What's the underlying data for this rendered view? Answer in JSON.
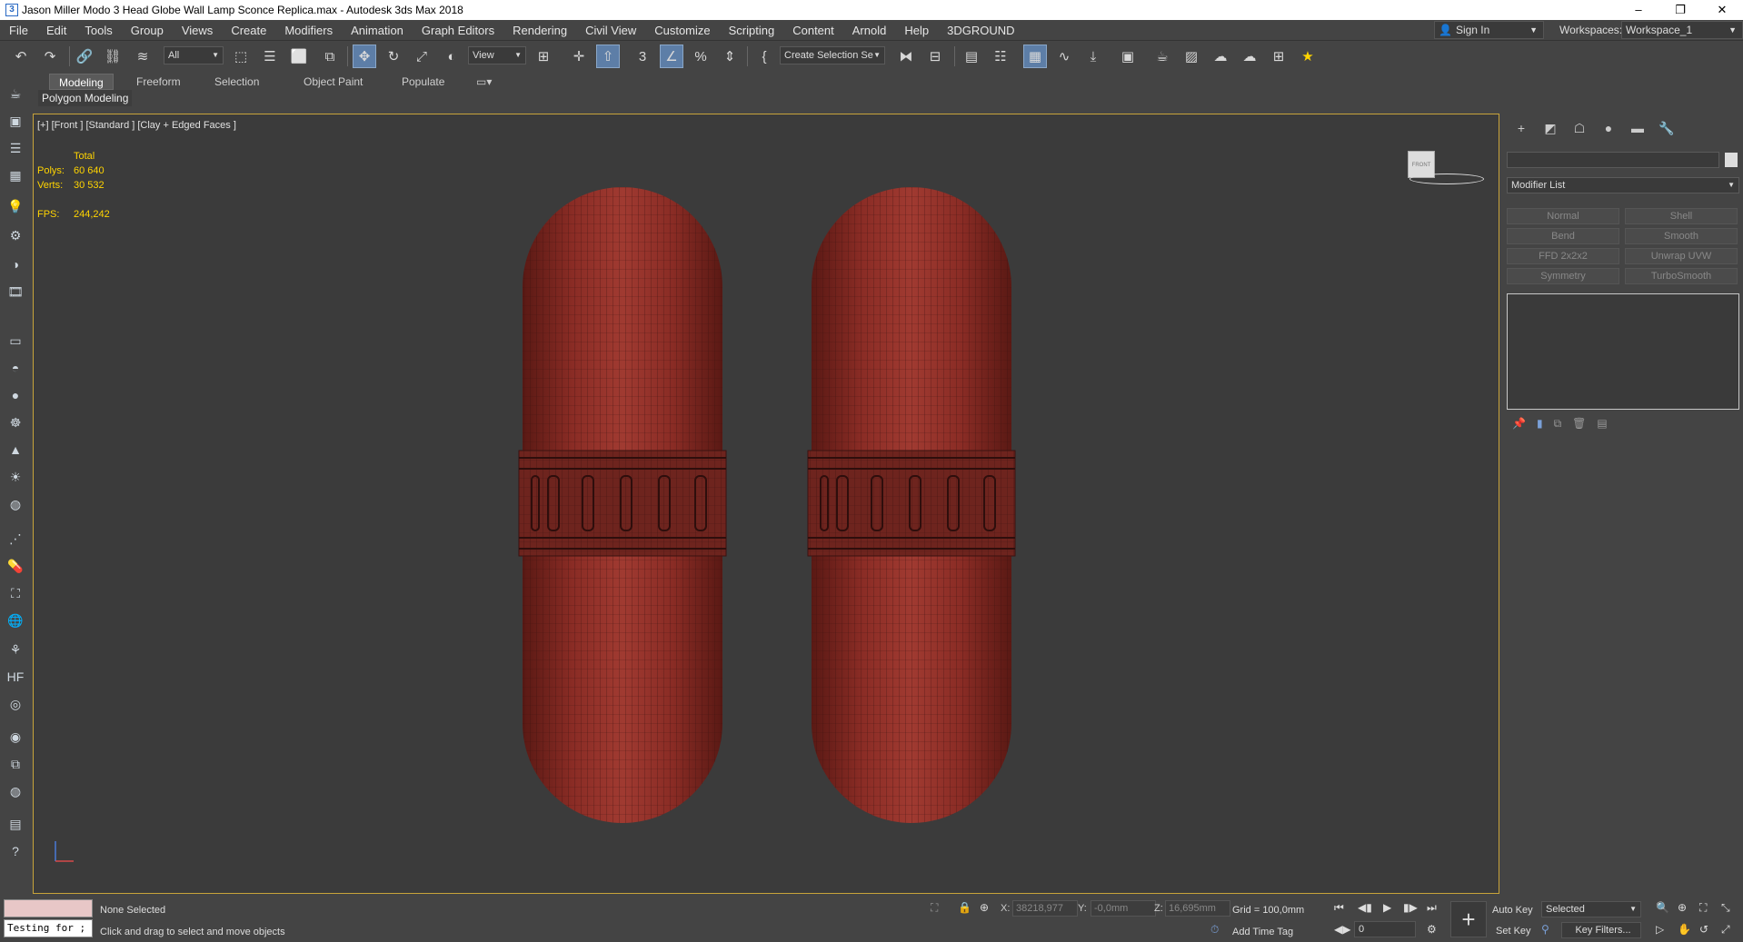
{
  "titlebar": {
    "title": "Jason Miller Modo 3 Head Globe Wall Lamp Sconce Replica.max - Autodesk 3ds Max 2018",
    "minimize": "–",
    "restore": "❐",
    "close": "✕"
  },
  "menu": {
    "items": [
      "File",
      "Edit",
      "Tools",
      "Group",
      "Views",
      "Create",
      "Modifiers",
      "Animation",
      "Graph Editors",
      "Rendering",
      "Civil View",
      "Customize",
      "Scripting",
      "Content",
      "Arnold",
      "Help",
      "3DGROUND"
    ],
    "sign_in": "Sign In",
    "workspaces_label": "Workspaces:",
    "workspace_value": "Workspace_1"
  },
  "toolbar": {
    "selection_filter": "All",
    "ref_coord": "View",
    "named_selection": "Create Selection Se"
  },
  "ribbon": {
    "tabs": [
      "Modeling",
      "Freeform",
      "Selection",
      "Object Paint",
      "Populate"
    ],
    "active_tab": "Modeling",
    "sub_label": "Polygon Modeling"
  },
  "viewport": {
    "label": "[+] [Front ] [Standard ] [Clay + Edged Faces ]",
    "stats": {
      "total_label": "Total",
      "polys_label": "Polys:",
      "polys_value": "60 640",
      "verts_label": "Verts:",
      "verts_value": "30 532",
      "fps_label": "FPS:",
      "fps_value": "244,242"
    },
    "viewcube_label": "FRONT",
    "object_color": "#8e2e27"
  },
  "command_panel": {
    "modifier_list": "Modifier List",
    "modifier_buttons": [
      "Normal",
      "Shell",
      "Bend",
      "Smooth",
      "FFD 2x2x2",
      "Unwrap UVW",
      "Symmetry",
      "TurboSmooth"
    ]
  },
  "status": {
    "maxscript_text": "Testing for ;",
    "selection_status": "None Selected",
    "prompt": "Click and drag to select and move objects",
    "x_label": "X:",
    "x_value": "38218,977",
    "y_label": "Y:",
    "y_value": "-0,0mm",
    "z_label": "Z:",
    "z_value": "16,695mm",
    "grid": "Grid = 100,0mm",
    "add_time_tag": "Add Time Tag",
    "auto_key": "Auto Key",
    "set_key": "Set Key",
    "key_mode": "Selected",
    "key_filters": "Key Filters...",
    "frame": "0"
  }
}
